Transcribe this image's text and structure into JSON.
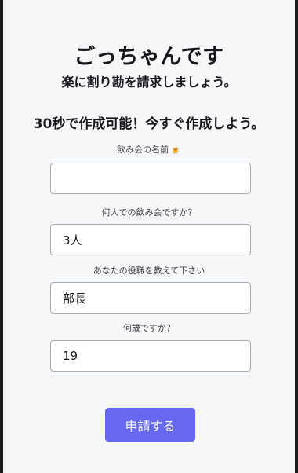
{
  "header": {
    "title": "ごっちゃんです",
    "subtitle": "楽に割り勘を請求しましょう。",
    "tagline": "30秒で作成可能！今すぐ作成しよう。"
  },
  "form": {
    "fields": [
      {
        "label": "飲み会の名前",
        "icon": "beer-mug-icon",
        "icon_glyph": "🍺",
        "value": "",
        "placeholder": ""
      },
      {
        "label": "何人での飲み会ですか？",
        "value": "3人",
        "placeholder": ""
      },
      {
        "label": "あなたの役職を教えて下さい",
        "value": "部長",
        "placeholder": ""
      },
      {
        "label": "何歳ですか？",
        "value": "19",
        "placeholder": ""
      }
    ],
    "submit_label": "申請する"
  },
  "colors": {
    "accent": "#6668ef",
    "page_background": "#f6f7f9",
    "text": "#17171c",
    "input_border": "#a9abb2"
  }
}
